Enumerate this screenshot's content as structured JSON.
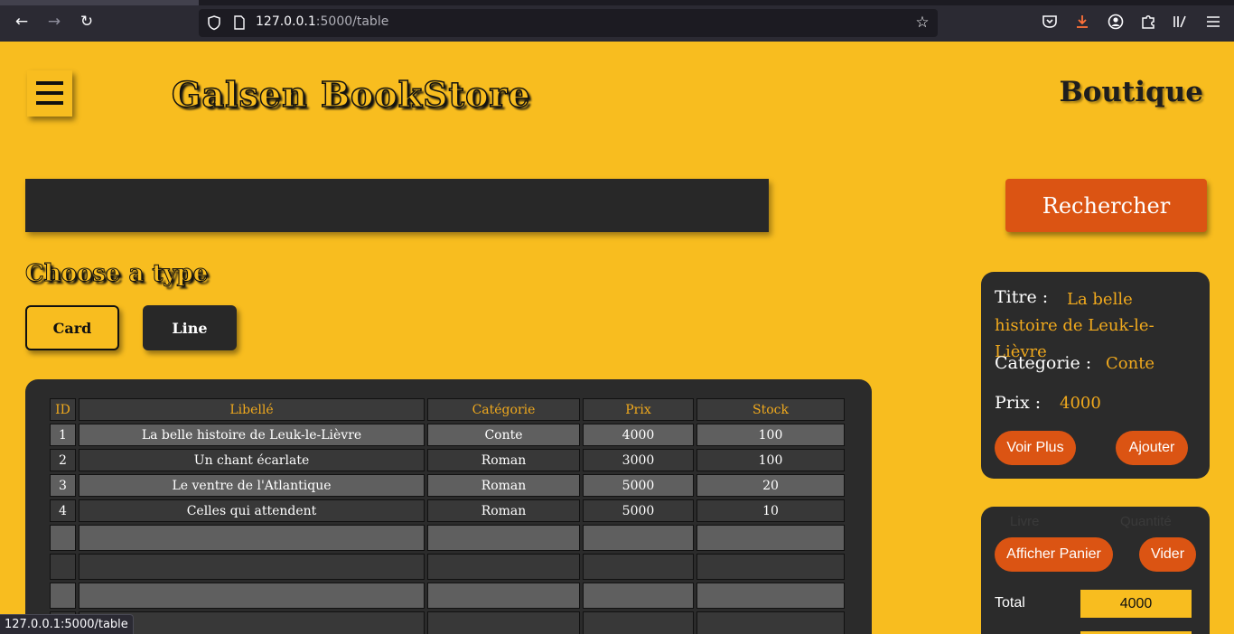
{
  "browser": {
    "url_host": "127.0.0.1",
    "url_path": ":5000/table",
    "icons": [
      "back-icon",
      "forward-icon",
      "reload-icon",
      "shield-icon",
      "page-icon",
      "bookmark-star-icon",
      "pocket-icon",
      "download-icon",
      "account-icon",
      "extensions-icon",
      "reader-icon",
      "menu-icon"
    ]
  },
  "header": {
    "brand": "Galsen BookStore",
    "section": "Boutique"
  },
  "search": {
    "placeholder": "",
    "button_label": "Rechercher"
  },
  "type_chooser": {
    "title": "Choose a type",
    "options": [
      "Card",
      "Line"
    ]
  },
  "table": {
    "columns": [
      "ID",
      "Libellé",
      "Catégorie",
      "Prix",
      "Stock"
    ],
    "rows": [
      {
        "id": "1",
        "libelle": "La belle histoire de Leuk-le-Lièvre",
        "categorie": "Conte",
        "prix": "4000",
        "stock": "100"
      },
      {
        "id": "2",
        "libelle": "Un chant écarlate",
        "categorie": "Roman",
        "prix": "3000",
        "stock": "100"
      },
      {
        "id": "3",
        "libelle": "Le ventre de l'Atlantique",
        "categorie": "Roman",
        "prix": "5000",
        "stock": "20"
      },
      {
        "id": "4",
        "libelle": "Celles qui attendent",
        "categorie": "Roman",
        "prix": "5000",
        "stock": "10"
      }
    ]
  },
  "detail": {
    "titre_label": "Titre :",
    "titre_value": "La belle histoire de Leuk-le-Lièvre",
    "categorie_label": "Categorie :",
    "categorie_value": "Conte",
    "prix_label": "Prix :",
    "prix_value": "4000",
    "voir_plus": "Voir Plus",
    "ajouter": "Ajouter"
  },
  "cart": {
    "head_left": "Livre",
    "head_right": "Quantité",
    "show_cart": "Afficher Panier",
    "clear": "Vider",
    "total_label": "Total",
    "total_value": "4000"
  },
  "status_bar": {
    "link": "127.0.0.1:5000/table"
  },
  "colors": {
    "page_bg": "#f8bd1f",
    "dark_panel": "#2b2b2b",
    "accent_orange": "#db5413",
    "header_text_gold": "#f0a91d"
  }
}
